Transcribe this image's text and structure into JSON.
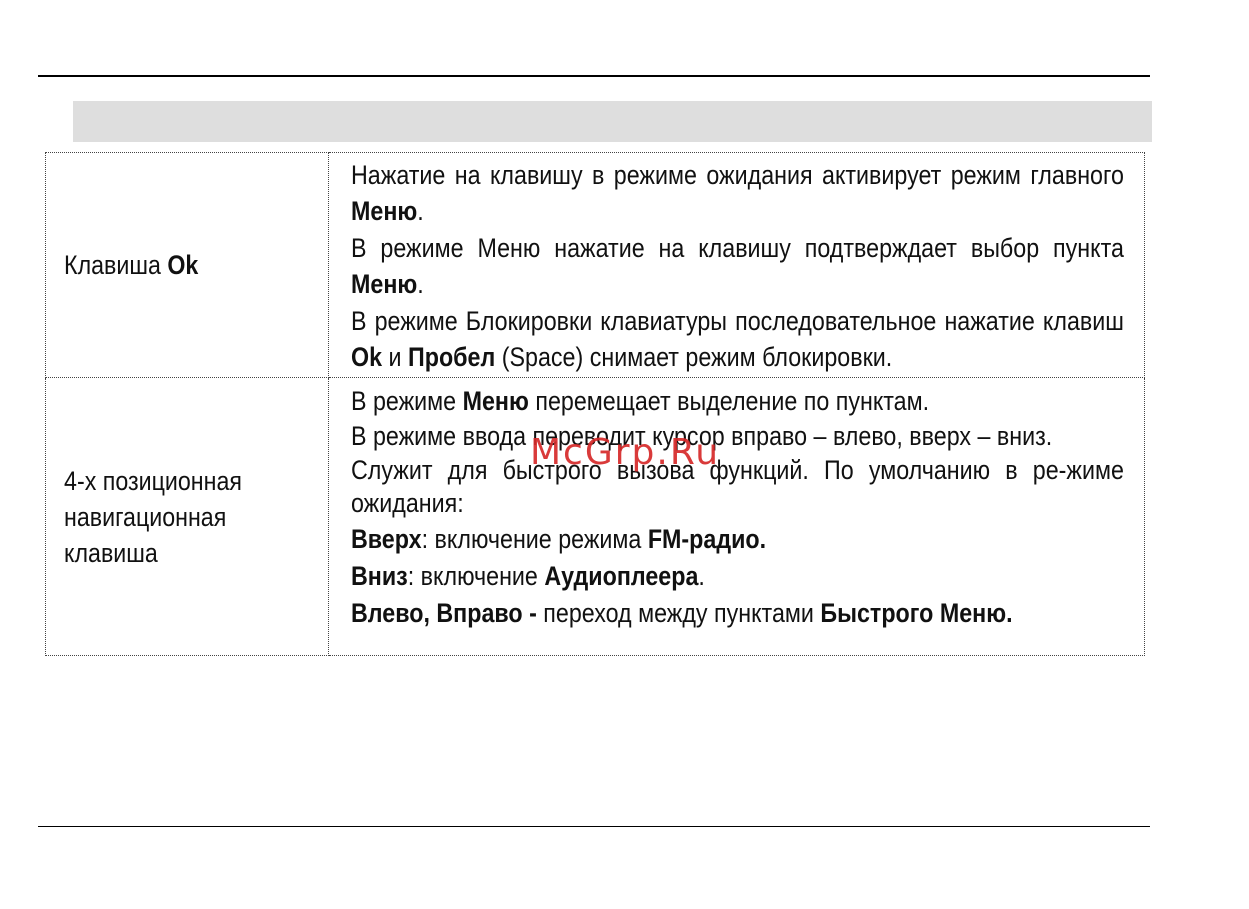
{
  "table": {
    "rows": [
      {
        "key": {
          "text": "Клавиша ",
          "bold": "Ok"
        },
        "paragraphs": [
          {
            "t1": "Нажатие на клавишу в режиме ожидания активирует режим главного ",
            "b1": "Меню",
            "t2": "."
          },
          {
            "t1": "В режиме Меню нажатие на клавишу подтверждает выбор пункта ",
            "b1": "Меню",
            "t2": "."
          },
          {
            "t1": "В режиме Блокировки клавиатуры последовательное нажатие клавиш ",
            "b1": "Ok",
            "t2": " и ",
            "b2": "Пробел",
            "t3": " (Space) снимает режим блокировки."
          }
        ]
      },
      {
        "key": {
          "line1": "4-х позиционная",
          "line2": "навигационная",
          "line3": "клавиша"
        },
        "paragraphs": [
          {
            "t1": "В режиме ",
            "b1": "Меню",
            "t2": " перемещает выделение по пунктам."
          },
          {
            "t1": "В режиме ввода переводит курсор вправо – влево, вверх – вниз."
          },
          {
            "t1": "Служит для быстрого вызова функций. По умолчанию в ре-жиме ожидания:"
          },
          {
            "b1": "Вверх",
            "t1": ": включение режима ",
            "b2": "FM-радио."
          },
          {
            "b1": "Вниз",
            "t1": ": включение ",
            "b2": "Аудиоплеера",
            "t2": "."
          },
          {
            "b1": "Влево, Вправо -",
            "t1": " переход между пунктами ",
            "b2": "Быстрого Меню."
          }
        ]
      }
    ]
  },
  "watermark": "McGrp.Ru"
}
